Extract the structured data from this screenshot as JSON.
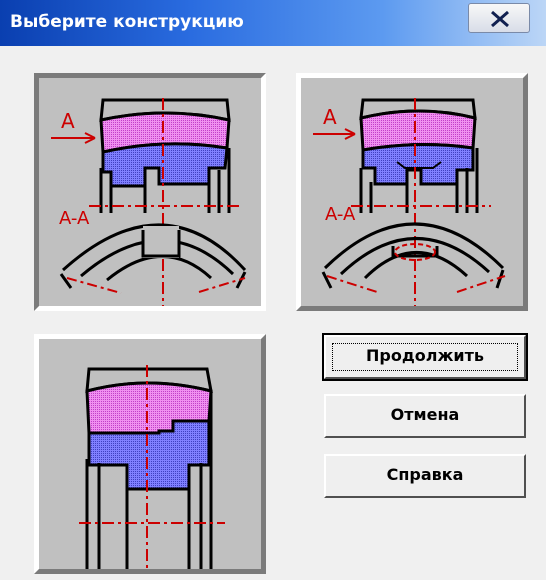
{
  "dialog": {
    "title": "Выберите конструкцию",
    "close_icon": "close-x-icon"
  },
  "options": [
    {
      "id": "option-1",
      "state": "selected",
      "labels": {
        "view": "A",
        "section": "A-A"
      }
    },
    {
      "id": "option-2",
      "state": "normal",
      "labels": {
        "view": "A",
        "section": "A-A"
      }
    },
    {
      "id": "option-3",
      "state": "normal"
    }
  ],
  "buttons": {
    "continue_label": "Продолжить",
    "cancel_label": "Отмена",
    "help_label": "Справка"
  },
  "colors": {
    "title_bar_start": "#0a3fb0",
    "tile_bg": "#c0c0c0",
    "magenta_fill": "#e070e8",
    "blue_fill": "#7070f0",
    "axis_red": "#cc0000"
  }
}
